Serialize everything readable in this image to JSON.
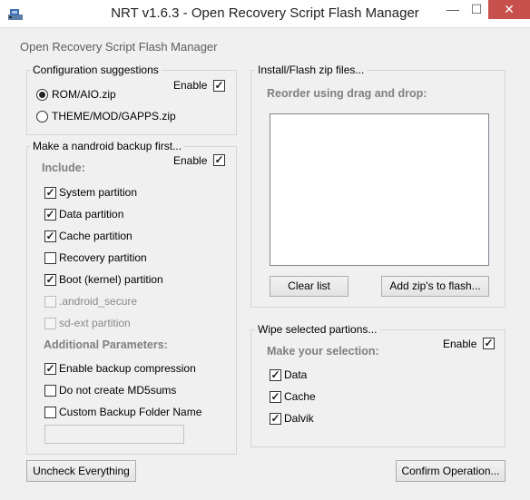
{
  "window": {
    "title": "NRT v1.6.3 - Open Recovery Script Flash Manager",
    "minimize_glyph": "—",
    "maximize_glyph": "☐",
    "close_glyph": "✕",
    "app_icon": "flash-app-icon"
  },
  "header_label": "Open Recovery Script Flash Manager",
  "config": {
    "title": "Configuration suggestions",
    "enable_label": "Enable",
    "enabled": true,
    "options": [
      {
        "label": "ROM/AIO.zip",
        "selected": true
      },
      {
        "label": "THEME/MOD/GAPPS.zip",
        "selected": false
      }
    ]
  },
  "backup": {
    "title": "Make a nandroid backup first...",
    "enable_label": "Enable",
    "enabled": true,
    "include_label": "Include:",
    "items": [
      {
        "label": "System partition",
        "checked": true,
        "disabled": false
      },
      {
        "label": "Data partition",
        "checked": true,
        "disabled": false
      },
      {
        "label": "Cache partition",
        "checked": true,
        "disabled": false
      },
      {
        "label": "Recovery partition",
        "checked": false,
        "disabled": false
      },
      {
        "label": "Boot (kernel) partition",
        "checked": true,
        "disabled": false
      },
      {
        "label": ".android_secure",
        "checked": false,
        "disabled": true
      },
      {
        "label": "sd-ext partition",
        "checked": false,
        "disabled": true
      }
    ],
    "params_label": "Additional Parameters:",
    "params": [
      {
        "label": "Enable backup compression",
        "checked": true
      },
      {
        "label": "Do not create MD5sums",
        "checked": false
      },
      {
        "label": "Custom Backup Folder Name",
        "checked": false
      }
    ],
    "folder_name_value": ""
  },
  "install": {
    "title": "Install/Flash zip files...",
    "reorder_label": "Reorder using drag and drop:",
    "items": [],
    "clear_label": "Clear list",
    "add_label": "Add zip's to flash..."
  },
  "wipe": {
    "title": "Wipe selected partions...",
    "enable_label": "Enable",
    "enabled": true,
    "selection_label": "Make your selection:",
    "items": [
      {
        "label": "Data",
        "checked": true
      },
      {
        "label": "Cache",
        "checked": true
      },
      {
        "label": "Dalvik",
        "checked": true
      }
    ]
  },
  "footer": {
    "uncheck_label": "Uncheck Everything",
    "confirm_label": "Confirm Operation..."
  },
  "check_glyph": "✓"
}
